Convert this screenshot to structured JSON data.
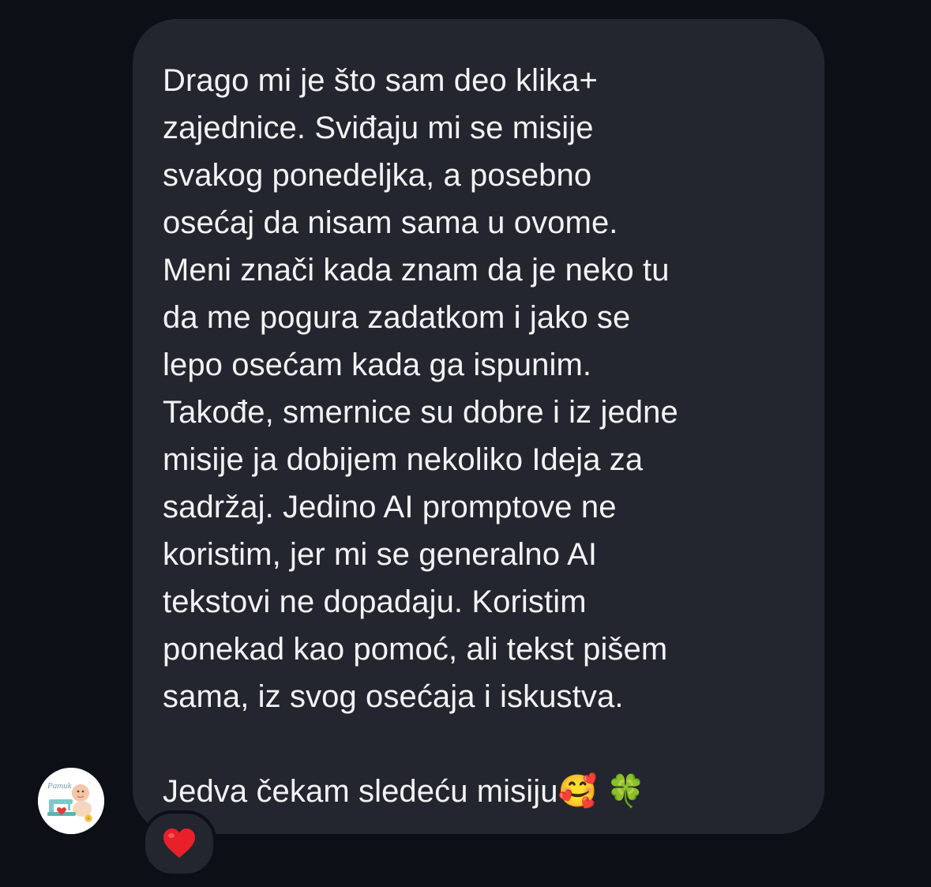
{
  "message": {
    "text": "Drago mi je što sam deo klika+\nzajednice. Sviđaju mi se misije\nsvakog ponedeljka, a posebno\nosećaj da nisam sama u ovome.\nMeni znači kada znam da je neko tu\nda me pogura zadatkom i jako se\nlepo osećam kada ga ispunim.\nTakođe, smernice su dobre i iz jedne\nmisije ja dobijem nekoliko Ideja za\nsadržaj. Jedino AI promptove ne\nkoristim, jer mi se generalno AI\ntekstovi ne dopadaju. Koristim\nponekad kao pomoć, ali tekst pišem\nsama, iz svog osećaja i iskustva.\n\nJedva čekam sledeću misiju",
    "trailing_emojis": [
      "🥰",
      "🍀"
    ]
  },
  "avatar": {
    "logo_text": "Pamuk",
    "icon": "sewing-machine-baby-logo"
  },
  "reaction": {
    "icon": "red-heart-icon",
    "color": "#e8202a"
  },
  "colors": {
    "background": "#0c0f16",
    "bubble": "#23262e",
    "text": "#f2f3f5"
  }
}
